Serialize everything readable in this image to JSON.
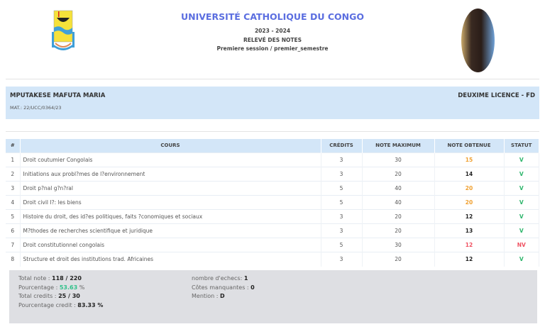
{
  "header": {
    "university": "UNIVERSITÉ CATHOLIQUE DU CONGO",
    "year": "2023 - 2024",
    "doc_title": "RELEVÉ DES NOTES",
    "session": "Premiere session / premier_semestre"
  },
  "student": {
    "name": "MPUTAKESE MAFUTA MARIA",
    "matricule": "MAT.: 22/UCC/0364/23",
    "level": "DEUXIME LICENCE - FD"
  },
  "table": {
    "headers": [
      "#",
      "COURS",
      "CRÉDITS",
      "NOTE MAXIMUM",
      "NOTE OBTENUE",
      "STATUT"
    ],
    "rows": [
      {
        "n": "1",
        "cours": "Droit coutumier Congolais",
        "credits": "3",
        "max": "30",
        "note": "15",
        "color": "orange",
        "statut": "V"
      },
      {
        "n": "2",
        "cours": "Initiations aux probl?mes de l?environnement",
        "credits": "3",
        "max": "20",
        "note": "14",
        "color": "black",
        "statut": "V"
      },
      {
        "n": "3",
        "cours": "Droit p?nal g?n?ral",
        "credits": "5",
        "max": "40",
        "note": "20",
        "color": "orange",
        "statut": "V"
      },
      {
        "n": "4",
        "cours": "Droit civil I?: les biens",
        "credits": "5",
        "max": "40",
        "note": "20",
        "color": "orange",
        "statut": "V"
      },
      {
        "n": "5",
        "cours": "Histoire du droit, des id?es politiques, faits ?conomiques et sociaux",
        "credits": "3",
        "max": "20",
        "note": "12",
        "color": "black",
        "statut": "V"
      },
      {
        "n": "6",
        "cours": "M?thodes de recherches scientifique et juridique",
        "credits": "3",
        "max": "20",
        "note": "13",
        "color": "black",
        "statut": "V"
      },
      {
        "n": "7",
        "cours": "Droit constitutionnel congolais",
        "credits": "5",
        "max": "30",
        "note": "12",
        "color": "red",
        "statut": "NV"
      },
      {
        "n": "8",
        "cours": "Structure et droit des institutions trad. Africaines",
        "credits": "3",
        "max": "20",
        "note": "12",
        "color": "black",
        "statut": "V"
      }
    ]
  },
  "summary": {
    "total_note_label": "Total note :",
    "total_note": "118 / 220",
    "pct_label": "Pourcentage :",
    "pct": "53.63",
    "pct_unit": "%",
    "total_credits_label": "Total credits :",
    "total_credits": "25 / 30",
    "pct_credit_label": "Pourcentage credit :",
    "pct_credit": "83.33 %",
    "echecs_label": "nombre d'echecs:",
    "echecs": "1",
    "cotes_label": "Côtes manquantes :",
    "cotes": "0",
    "mention_label": "Mention :",
    "mention": "D"
  }
}
